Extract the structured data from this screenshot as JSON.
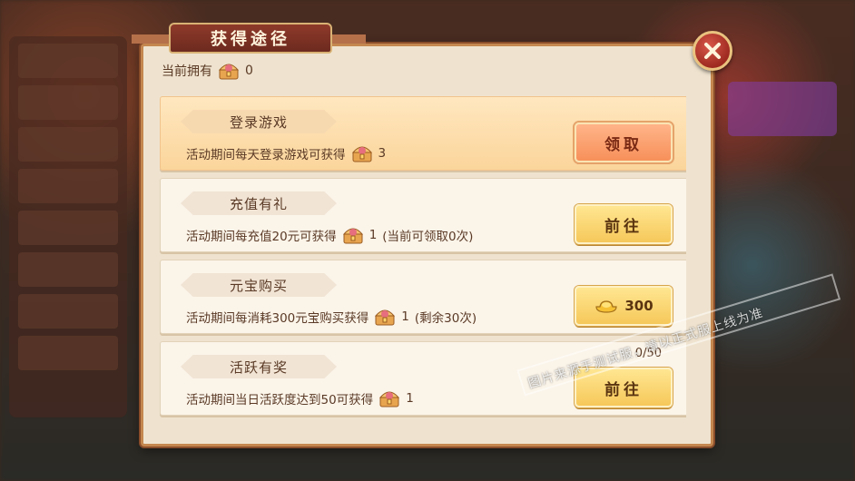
{
  "dialog": {
    "title": "获得途径",
    "owned_label": "当前拥有",
    "owned_count": "0"
  },
  "tasks": [
    {
      "name": "登录游戏",
      "desc_prefix": "活动期间每天登录游戏可获得",
      "reward": "3",
      "desc_suffix": "",
      "button_label": "领取",
      "button_kind": "claim",
      "progress": ""
    },
    {
      "name": "充值有礼",
      "desc_prefix": "活动期间每充值20元可获得",
      "reward": "1",
      "desc_suffix": "(当前可领取0次)",
      "button_label": "前往",
      "button_kind": "go",
      "progress": ""
    },
    {
      "name": "元宝购买",
      "desc_prefix": "活动期间每消耗300元宝购买获得",
      "reward": "1",
      "desc_suffix": "(剩余30次)",
      "button_label": "300",
      "button_kind": "price",
      "progress": ""
    },
    {
      "name": "活跃有奖",
      "desc_prefix": "活动期间当日活跃度达到50可获得",
      "reward": "1",
      "desc_suffix": "",
      "button_label": "前往",
      "button_kind": "go",
      "progress": "0/50"
    }
  ],
  "watermark": "图片来源于测试服，请以正式服上线为准",
  "colors": {
    "panel_bg": "#efe3cf",
    "title_banner": "#8e3a2a",
    "claim_button": "#f7905a",
    "go_button": "#f6c85a",
    "close_button": "#c0392b"
  },
  "icons": {
    "item": "treasure-chest-icon",
    "price": "gold-ingot-icon",
    "close": "close-icon"
  }
}
